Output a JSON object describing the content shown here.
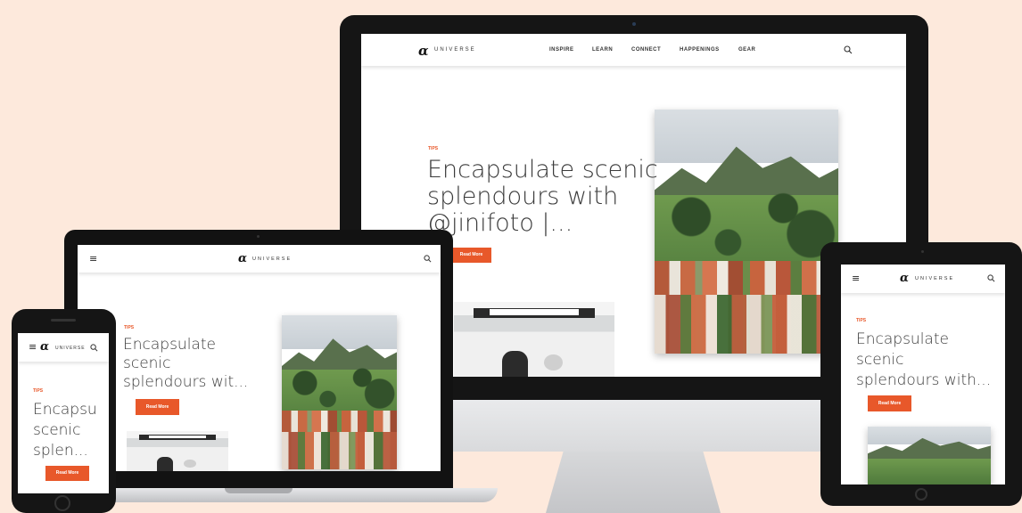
{
  "brand": {
    "logo_glyph": "α",
    "wordmark": "UNIVERSE"
  },
  "nav": {
    "items": [
      "INSPIRE",
      "LEARN",
      "CONNECT",
      "HAPPENINGS",
      "GEAR"
    ]
  },
  "icons": {
    "menu": "hamburger-menu-icon",
    "search": "search-icon",
    "logo": "alpha-logo-icon"
  },
  "article": {
    "category": "TIPS",
    "button_label": "Read More"
  },
  "desktop": {
    "headline_lines": [
      "Encapsulate scenic",
      "splendours with",
      "@jinifoto |..."
    ]
  },
  "laptop": {
    "headline_lines": [
      "Encapsulate",
      "scenic",
      "splendours wit..."
    ]
  },
  "tablet": {
    "headline_lines": [
      "Encapsulate",
      "scenic",
      "splendours with..."
    ]
  },
  "phone": {
    "headline_lines": [
      "Encapsu",
      "scenic",
      "splen..."
    ]
  },
  "colors": {
    "background": "#fde9dc",
    "accent": "#e8582a",
    "device_frame": "#151515"
  }
}
